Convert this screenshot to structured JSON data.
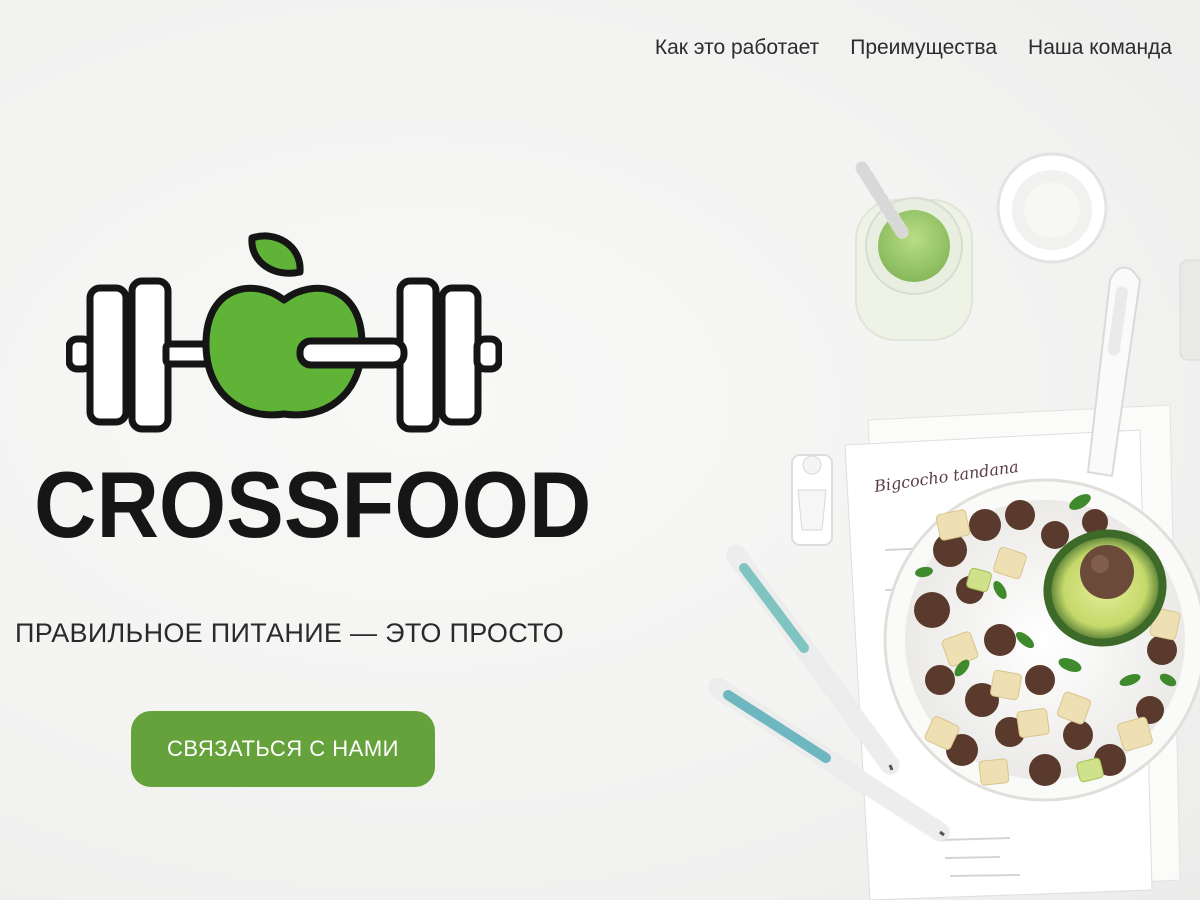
{
  "nav": {
    "items": [
      {
        "label": "Как это работает"
      },
      {
        "label": "Преимущества"
      },
      {
        "label": "Наша команда"
      }
    ]
  },
  "hero": {
    "brand": "CROSSFOOD",
    "tagline": "ПРАВИЛЬНОЕ ПИТАНИЕ — ЭТО ПРОСТО",
    "cta_label": "СВЯЗАТЬСЯ С НАМИ",
    "photo_note": "Bigcocho tandana"
  },
  "colors": {
    "brand_green": "#65a23c",
    "logo_green": "#5fb336",
    "logo_outline": "#151515",
    "background": "#f4f4f3"
  },
  "icons": {
    "logo": "dumbbell-apple-logo-icon"
  }
}
